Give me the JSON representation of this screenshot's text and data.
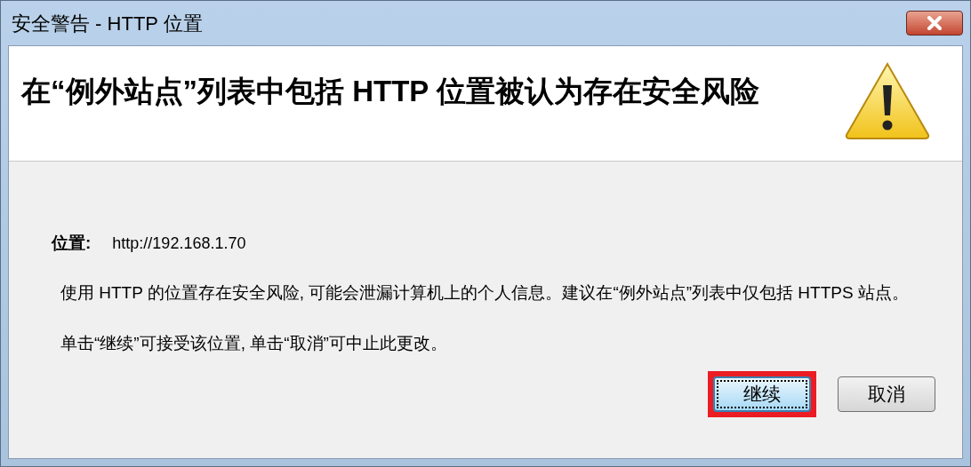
{
  "window": {
    "title": "安全警告 - HTTP 位置"
  },
  "header": {
    "message": "在“例外站点”列表中包括 HTTP 位置被认为存在安全风险"
  },
  "location": {
    "label": "位置:",
    "value": "http://192.168.1.70"
  },
  "paragraphs": [
    "使用 HTTP 的位置存在安全风险, 可能会泄漏计算机上的个人信息。建议在“例外站点”列表中仅包括 HTTPS 站点。",
    "单击“继续”可接受该位置, 单击“取消”可中止此更改。"
  ],
  "buttons": [
    {
      "label": "继续",
      "default": true,
      "highlighted": true
    },
    {
      "label": "取消",
      "default": false,
      "highlighted": false
    }
  ]
}
